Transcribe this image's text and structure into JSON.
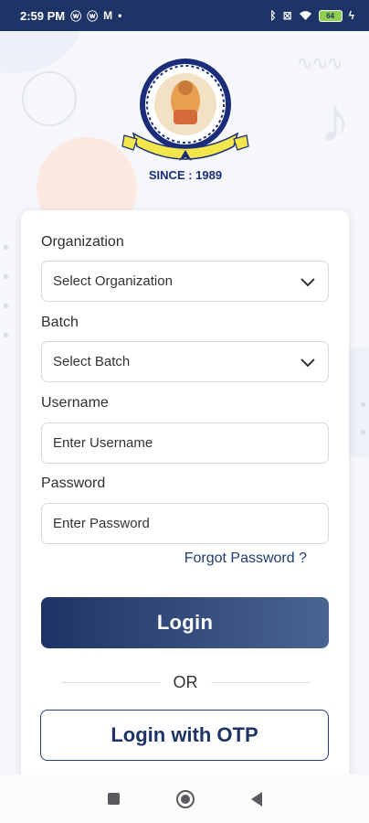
{
  "status_bar": {
    "time": "2:59 PM",
    "left_icons": [
      "whatsapp-icon",
      "whatsapp-icon",
      "gmail-icon"
    ],
    "dot": "•",
    "battery": "64",
    "right_icons": [
      "bluetooth-icon",
      "close-box-icon",
      "wifi-icon",
      "battery-icon",
      "charging-icon"
    ]
  },
  "logo": {
    "since_text": "SINCE : 1989",
    "colors": {
      "ring": "#1b2c7a",
      "ribbon": "#f2e64a"
    }
  },
  "form": {
    "organization_label": "Organization",
    "organization_select": "Select Organization",
    "batch_label": "Batch",
    "batch_select": "Select Batch",
    "username_label": "Username",
    "username_placeholder": "Enter Username",
    "password_label": "Password",
    "password_placeholder": "Enter Password",
    "forgot_password": "Forgot Password ?",
    "login_button": "Login",
    "or_text": "OR",
    "otp_button": "Login with OTP"
  },
  "theme": {
    "primary": "#1e3466",
    "primary_light": "#4a6491",
    "link": "#1f3b73"
  },
  "nav_bar": {
    "icons": [
      "recents-square-icon",
      "home-circle-icon",
      "back-triangle-icon"
    ]
  }
}
